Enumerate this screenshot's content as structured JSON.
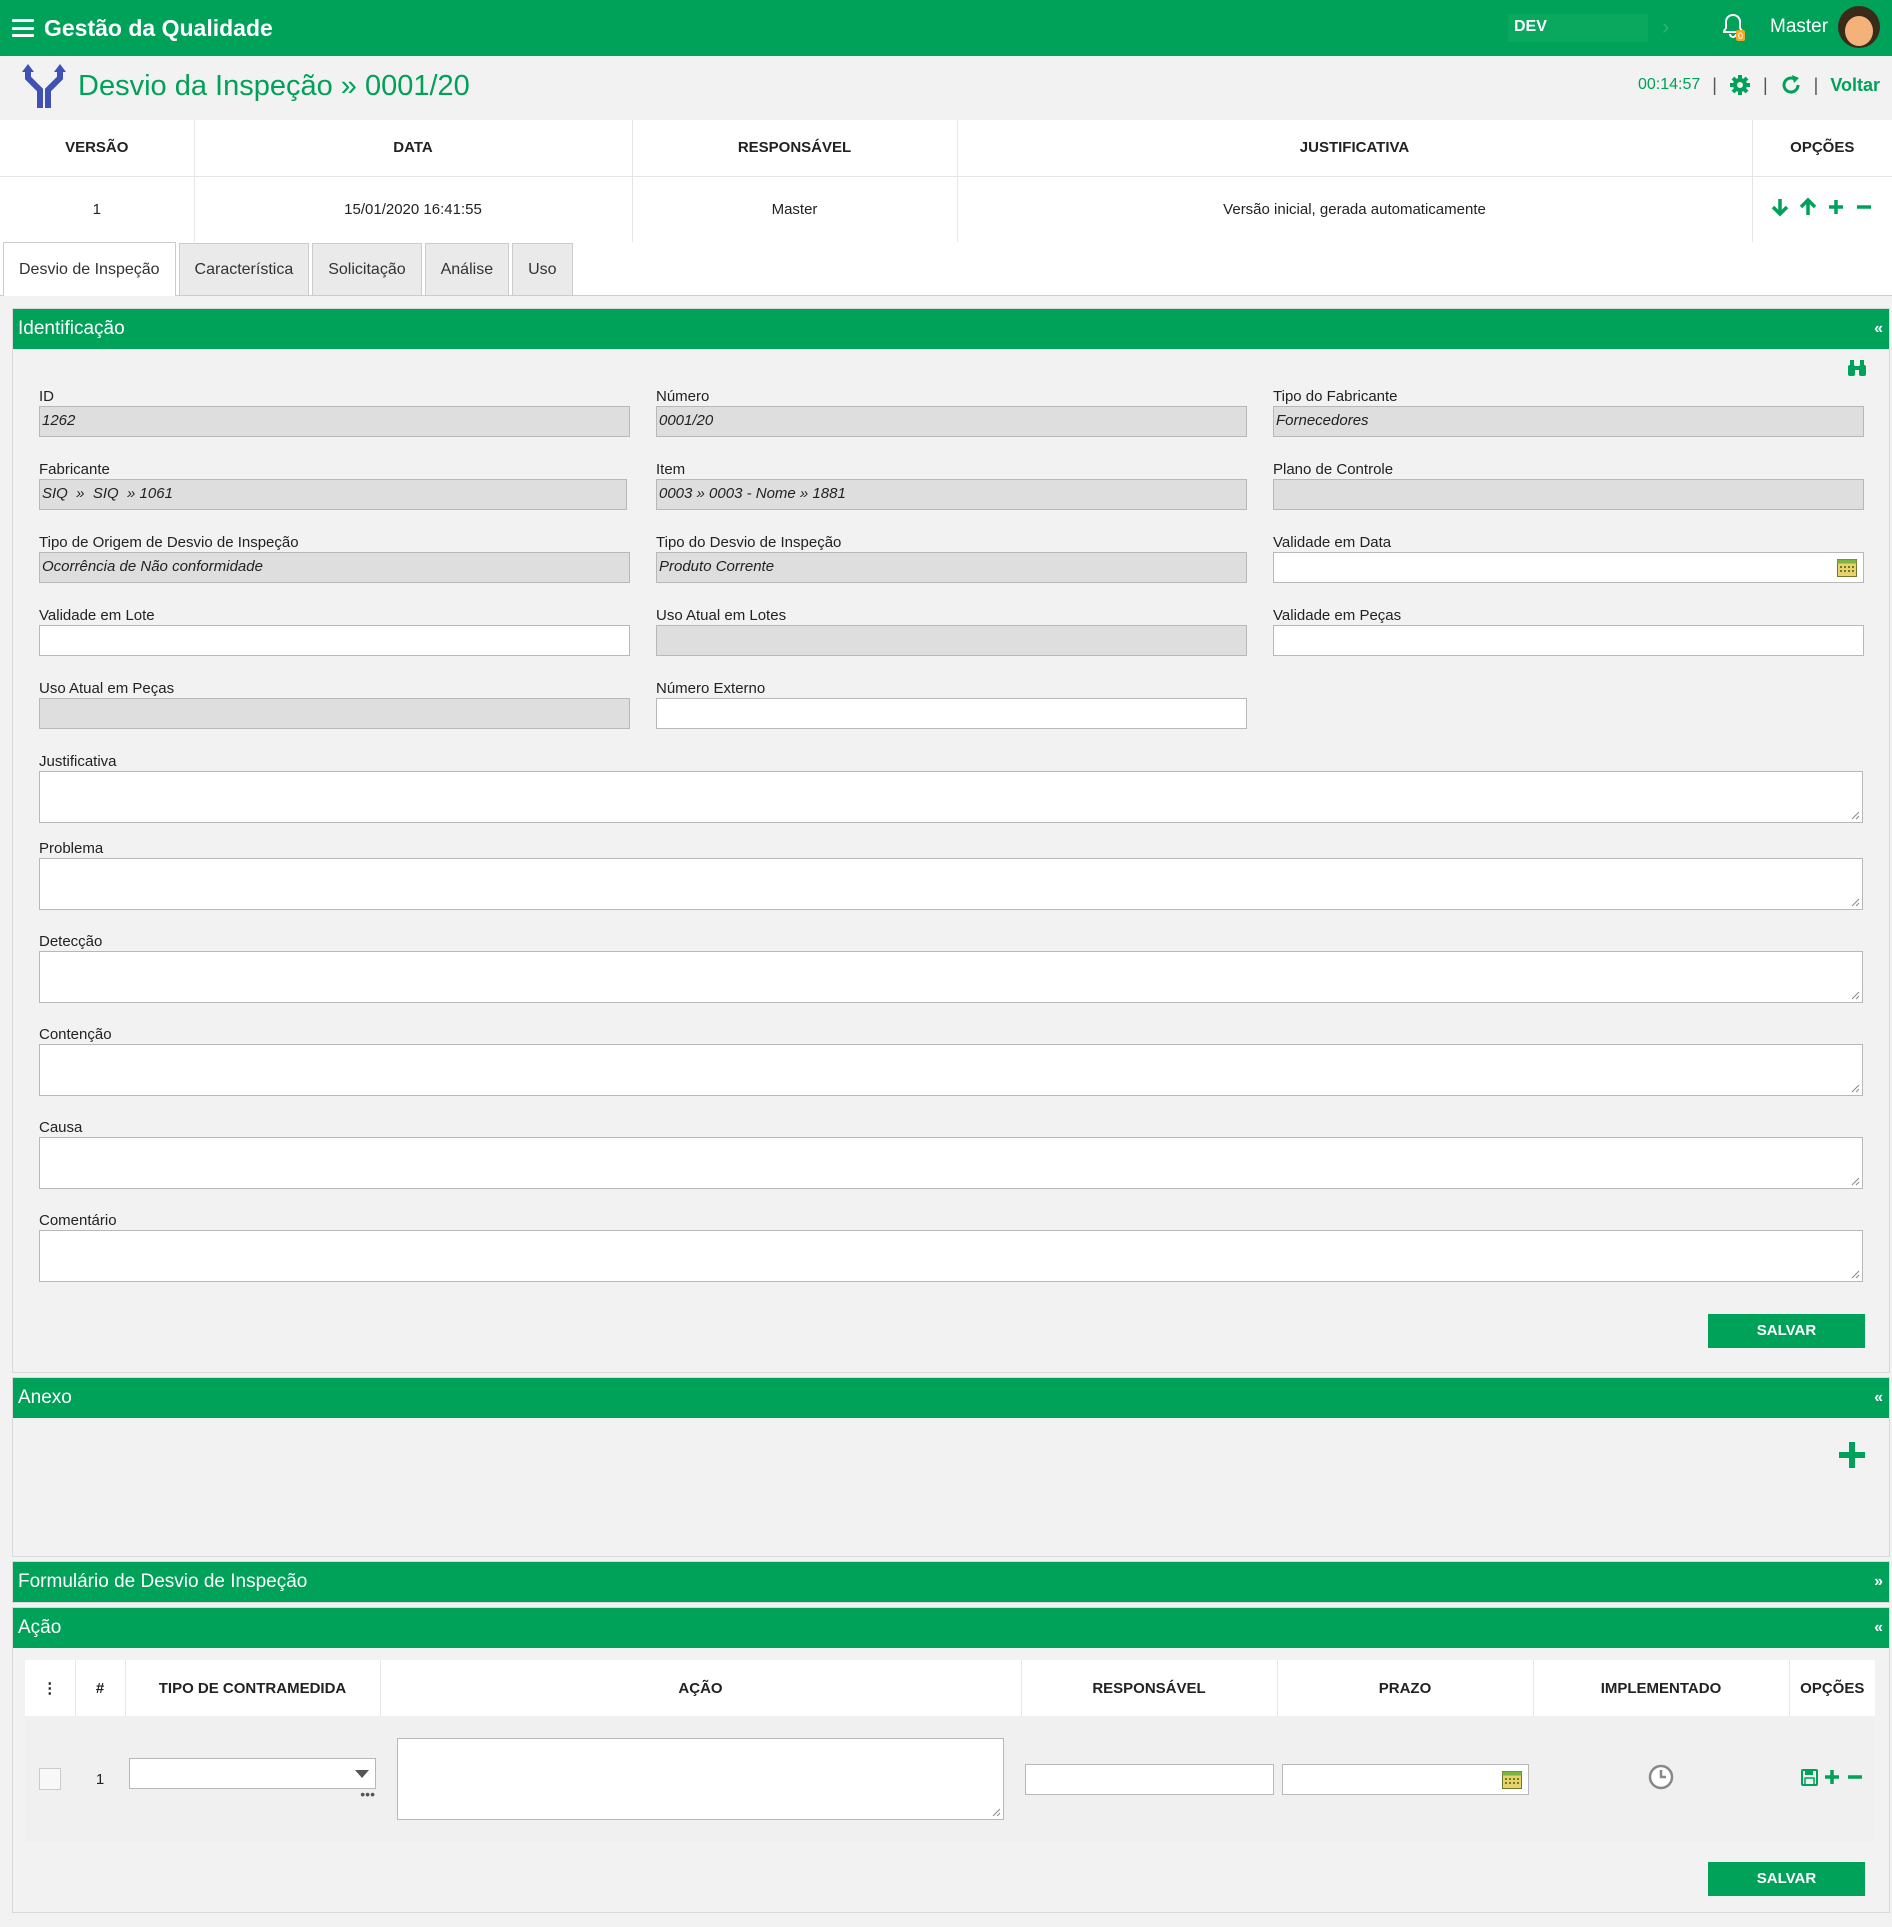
{
  "app": {
    "title": "Gestão da Qualidade",
    "env": "DEV",
    "notification_count": "0",
    "user": "Master"
  },
  "page": {
    "title": "Desvio da Inspeção » 0001/20",
    "timer": "00:14:57",
    "back_label": "Voltar"
  },
  "versions": {
    "headers": [
      "VERSÃO",
      "DATA",
      "RESPONSÁVEL",
      "JUSTIFICATIVA",
      "OPÇÕES"
    ],
    "rows": [
      {
        "versao": "1",
        "data": "15/01/2020 16:41:55",
        "responsavel": "Master",
        "justificativa": "Versão inicial, gerada automaticamente"
      }
    ]
  },
  "tabs": [
    {
      "label": "Desvio de Inspeção",
      "active": true
    },
    {
      "label": "Característica"
    },
    {
      "label": "Solicitação"
    },
    {
      "label": "Análise"
    },
    {
      "label": "Uso"
    }
  ],
  "identificacao": {
    "title": "Identificação",
    "fields": {
      "id": {
        "label": "ID",
        "value": "1262"
      },
      "numero": {
        "label": "Número",
        "value": "0001/20"
      },
      "tipo_fabricante": {
        "label": "Tipo do Fabricante",
        "value": "Fornecedores"
      },
      "fabricante": {
        "label": "Fabricante",
        "value": "SIQ  »  SIQ  » 1061"
      },
      "item": {
        "label": "Item",
        "value": "0003 » 0003 - Nome » 1881"
      },
      "plano_controle": {
        "label": "Plano de Controle",
        "value": ""
      },
      "tipo_origem": {
        "label": "Tipo de Origem de Desvio de Inspeção",
        "value": "Ocorrência de Não conformidade"
      },
      "tipo_desvio": {
        "label": "Tipo do Desvio de Inspeção",
        "value": "Produto Corrente"
      },
      "validade_data": {
        "label": "Validade em Data",
        "value": ""
      },
      "validade_lote": {
        "label": "Validade em Lote",
        "value": ""
      },
      "uso_lotes": {
        "label": "Uso Atual em Lotes",
        "value": ""
      },
      "validade_pecas": {
        "label": "Validade em Peças",
        "value": ""
      },
      "uso_pecas": {
        "label": "Uso Atual em Peças",
        "value": ""
      },
      "numero_externo": {
        "label": "Número Externo",
        "value": ""
      }
    },
    "textareas": {
      "justificativa": "Justificativa",
      "problema": "Problema",
      "deteccao": "Detecção",
      "contencao": "Contenção",
      "causa": "Causa",
      "comentario": "Comentário"
    },
    "save_label": "SALVAR"
  },
  "anexo": {
    "title": "Anexo"
  },
  "formulario": {
    "title": "Formulário de Desvio de Inspeção"
  },
  "acao": {
    "title": "Ação",
    "headers": [
      "⋮",
      "#",
      "TIPO DE CONTRAMEDIDA",
      "AÇÃO",
      "RESPONSÁVEL",
      "PRAZO",
      "IMPLEMENTADO",
      "OPÇÕES"
    ],
    "rows": [
      {
        "num": "1"
      }
    ],
    "save_label": "SALVAR"
  },
  "colors": {
    "brand": "#00a159",
    "page_title": "#00a159",
    "header_icon": "#3f51b5"
  }
}
